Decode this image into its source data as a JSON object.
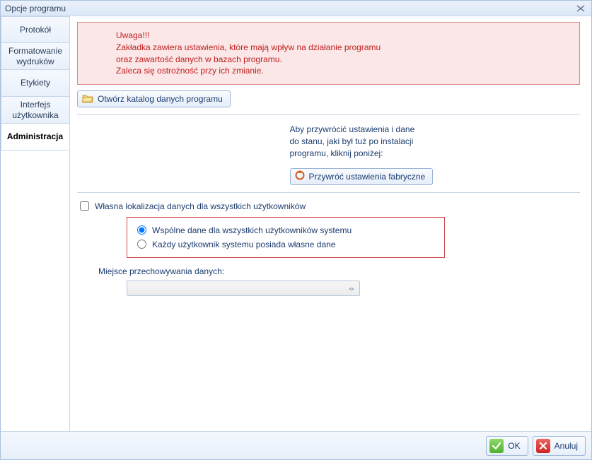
{
  "window": {
    "title": "Opcje programu"
  },
  "tabs": {
    "items": [
      {
        "label": "Protokół",
        "active": false
      },
      {
        "label": "Formatowanie wydruków",
        "active": false
      },
      {
        "label": "Etykiety",
        "active": false
      },
      {
        "label": "Interfejs użytkownika",
        "active": false
      },
      {
        "label": "Administracja",
        "active": true
      }
    ]
  },
  "warning": {
    "title": "Uwaga!!!",
    "line1": "Zakładka zawiera ustawienia, które mają wpływ na działanie programu",
    "line2": "oraz zawartość danych w bazach programu.",
    "line3": "Zaleca się ostrożność przy ich zmianie."
  },
  "buttons": {
    "open_catalog": "Otwórz katalog danych programu",
    "restore_factory": "Przywróć ustawienia fabryczne"
  },
  "restore_text": {
    "line1": "Aby przywrócić ustawienia i dane",
    "line2": "do stanu, jaki był tuż po instalacji",
    "line3": "programu, kliknij poniżej:"
  },
  "checkbox": {
    "own_location_label": "Własna lokalizacja danych dla wszystkich użytkowników",
    "own_location_checked": false
  },
  "radios": {
    "shared": "Wspólne dane dla wszystkich użytkowników systemu",
    "individual": "Każdy użytkownik systemu posiada własne dane",
    "selected": "shared"
  },
  "storage": {
    "label": "Miejsce przechowywania danych:",
    "value": ""
  },
  "footer": {
    "ok": "OK",
    "cancel": "Anuluj"
  },
  "icons": {
    "close": "✕",
    "folder": "folder-icon",
    "reset": "reset-icon",
    "check": "check-icon",
    "x": "x-icon",
    "dropdown": "chevron-down-icon"
  }
}
